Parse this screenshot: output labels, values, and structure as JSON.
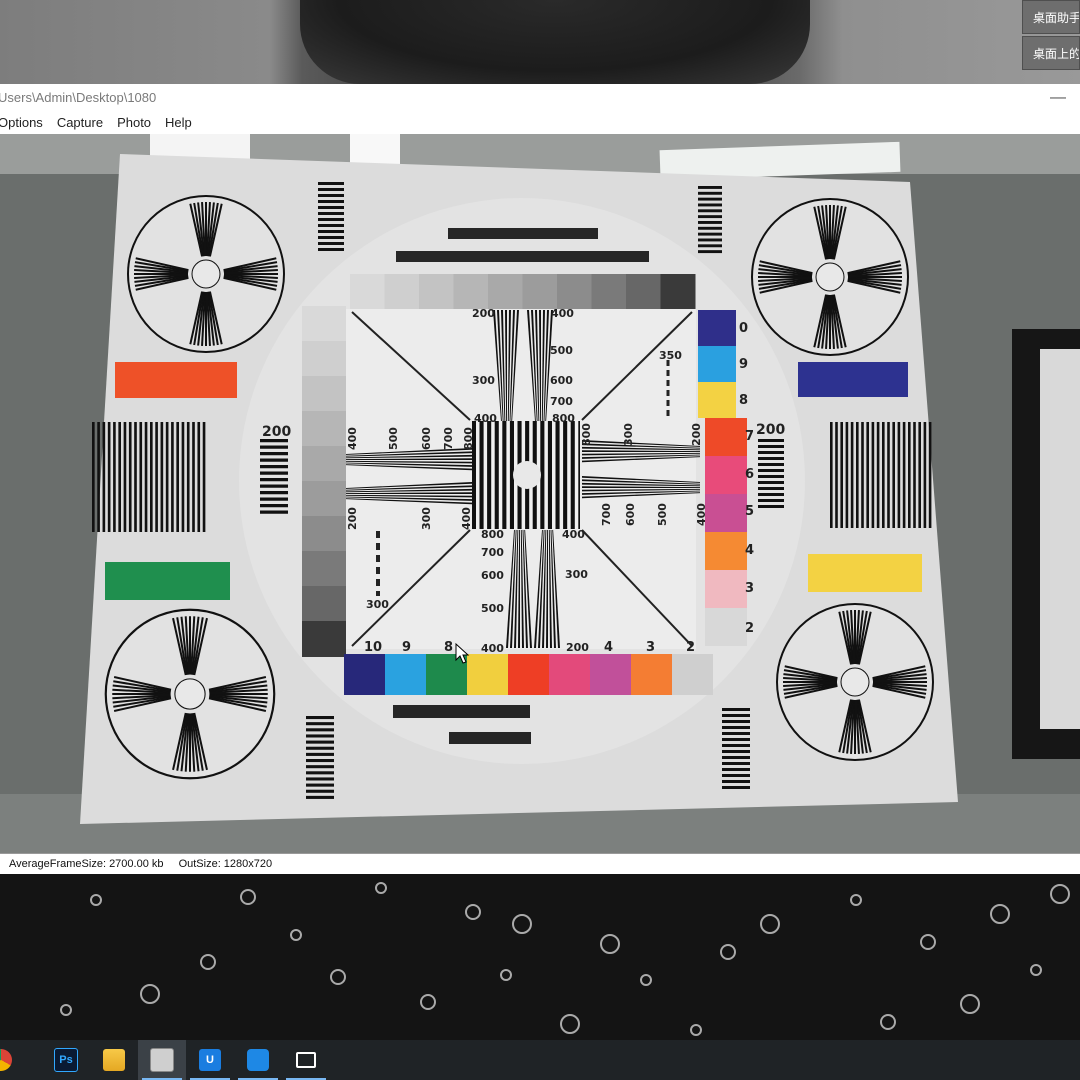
{
  "desktop": {
    "helper_buttons": [
      "桌面助手",
      "桌面上的"
    ]
  },
  "window": {
    "title": "Users\\Admin\\Desktop\\1080",
    "menu": [
      "Options",
      "Capture",
      "Photo",
      "Help"
    ],
    "status": {
      "average_frame_size": "AverageFrameSize: 2700.00 kb",
      "out_size": "OutSize: 1280x720"
    }
  },
  "test_chart": {
    "top_labels": [
      "200",
      "400",
      "500",
      "600",
      "700",
      "800",
      "350",
      "300"
    ],
    "left_labels": [
      "400",
      "500",
      "600",
      "700",
      "800",
      "200",
      "300",
      "400"
    ],
    "right_labels": [
      "800",
      "300",
      "200",
      "700",
      "600",
      "500",
      "400"
    ],
    "bottom_labels": [
      "800",
      "700",
      "600",
      "500",
      "400",
      "400",
      "300",
      "200",
      "300"
    ],
    "side_200": [
      "200",
      "200"
    ],
    "top_color_numbers": [
      "0",
      "9",
      "8",
      "7",
      "6",
      "5",
      "4",
      "3",
      "2"
    ],
    "bottom_color_numbers": [
      "10",
      "9",
      "8",
      "4",
      "3",
      "2"
    ],
    "gray_steps": [
      "#d9d9d9",
      "#cfcfcf",
      "#c3c3c3",
      "#b6b6b6",
      "#a9a9a9",
      "#9c9c9c",
      "#8c8c8c",
      "#7a7a7a",
      "#676767",
      "#3a3a3a"
    ],
    "right_swatches": [
      "#2f2f8a",
      "#2aa0e0",
      "#f3d243",
      "#ee4a28",
      "#e84b7a",
      "#c94f93",
      "#f58a33",
      "#f0b9c0",
      "#d8d8d8"
    ],
    "bottom_swatches": [
      "#27287a",
      "#2aa2e0",
      "#1e8a4c",
      "#f1cf3e",
      "#ee3e25",
      "#e34a7b",
      "#c1509a",
      "#f47d33",
      "#cfcfcf"
    ],
    "side_bars": {
      "left_top": "#ee5128",
      "left_bottom": "#1f8f4e",
      "right_top": "#2d3290",
      "right_bottom": "#f3d243"
    }
  },
  "taskbar": {
    "items": [
      {
        "name": "chrome-icon",
        "label": ""
      },
      {
        "name": "photoshop-icon",
        "label": "Ps"
      },
      {
        "name": "file-explorer-icon",
        "label": ""
      },
      {
        "name": "capture-app-icon",
        "label": ""
      },
      {
        "name": "app-u-icon",
        "label": "U"
      },
      {
        "name": "app-blue-icon",
        "label": ""
      },
      {
        "name": "camera-icon",
        "label": ""
      }
    ]
  }
}
